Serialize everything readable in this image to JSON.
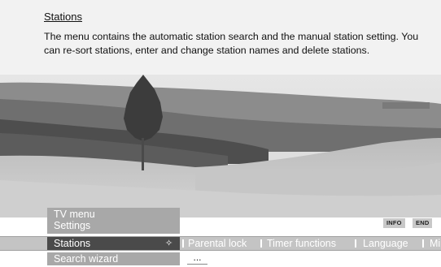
{
  "help": {
    "title": "Stations",
    "text": "The menu contains the automatic station search and the manual station setting. You can re-sort stations, enter and change station names and delete stations."
  },
  "menu": {
    "title": "TV menu",
    "subtitle": "Settings"
  },
  "buttons": {
    "info": "INFO",
    "end": "END"
  },
  "nav": {
    "selected": "Stations",
    "selected_arrow": "✧",
    "items": [
      "Parental lock",
      "Timer functions",
      "Language",
      "Mi"
    ]
  },
  "submenu": {
    "item": "Search wizard",
    "more": "..."
  }
}
